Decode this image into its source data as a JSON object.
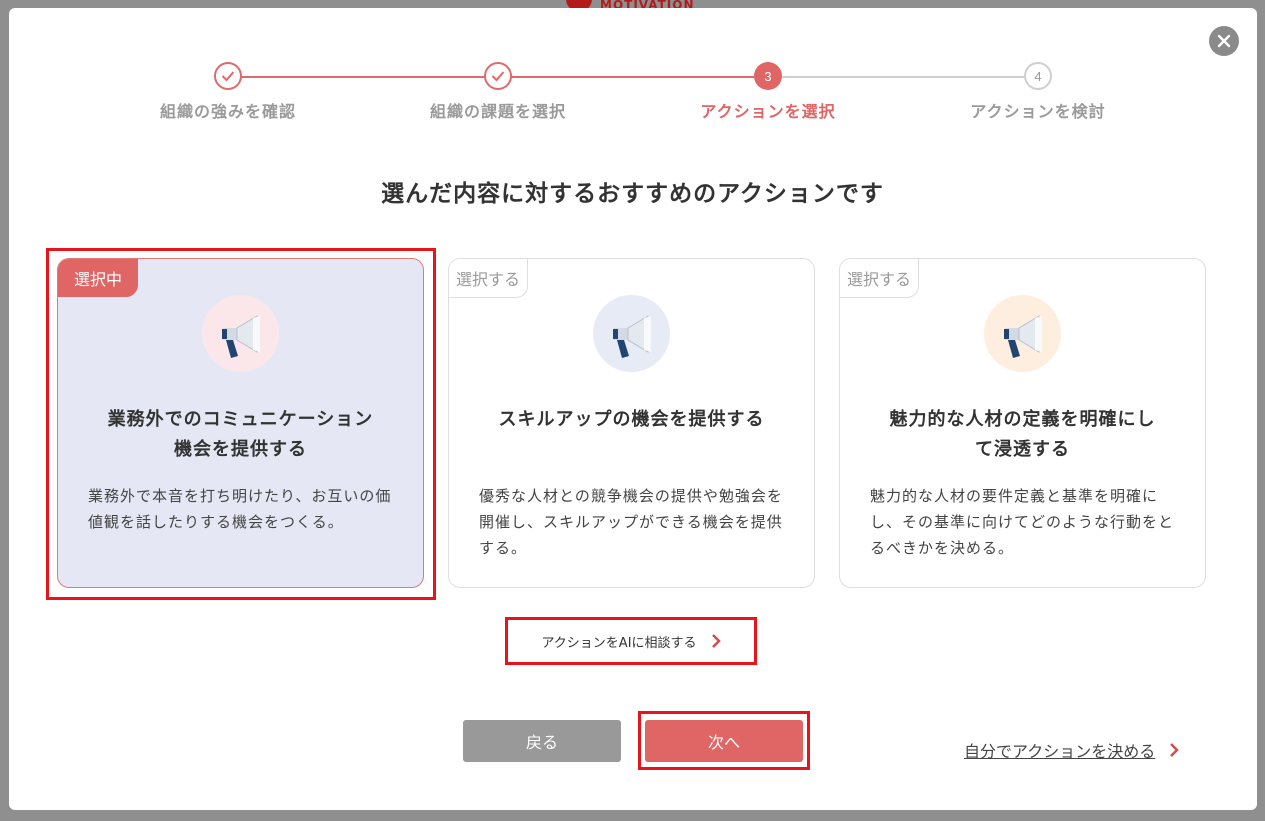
{
  "background": {
    "brand_text": "MOTIVATION"
  },
  "steps": [
    {
      "label": "組織の強みを確認",
      "state": "done"
    },
    {
      "label": "組織の課題を選択",
      "state": "done"
    },
    {
      "label": "アクションを選択",
      "state": "active",
      "number": "3"
    },
    {
      "label": "アクションを検討",
      "state": "todo",
      "number": "4"
    }
  ],
  "heading": "選んだ内容に対するおすすめのアクションです",
  "cards": [
    {
      "badge": "選択中",
      "selected": true,
      "title_line1": "業務外でのコミュニケーション",
      "title_line2": "機会を提供する",
      "description": "業務外で本音を打ち明けたり、お互いの価値観を話したりする機会をつくる。",
      "icon": "megaphone-icon",
      "icon_bg": "#fbe7ea"
    },
    {
      "badge": "選択する",
      "selected": false,
      "title_line1": "スキルアップの機会を提供する",
      "title_line2": "",
      "description": "優秀な人材との競争機会の提供や勉強会を開催し、スキルアップができる機会を提供する。",
      "icon": "megaphone-icon",
      "icon_bg": "#e6ebf5"
    },
    {
      "badge": "選択する",
      "selected": false,
      "title_line1": "魅力的な人材の定義を明確にし",
      "title_line2": "て浸透する",
      "description": "魅力的な人材の要件定義と基準を明確にし、その基準に向けてどのような行動をとるべきかを決める。",
      "icon": "megaphone-icon",
      "icon_bg": "#fdeee0"
    }
  ],
  "ai_link": "アクションをAIに相談する",
  "buttons": {
    "back": "戻る",
    "next": "次へ"
  },
  "self_link": "自分でアクションを決める",
  "colors": {
    "accent": "#e06666",
    "highlight": "#e8141c",
    "selected_card_bg": "#e5e8f4"
  }
}
